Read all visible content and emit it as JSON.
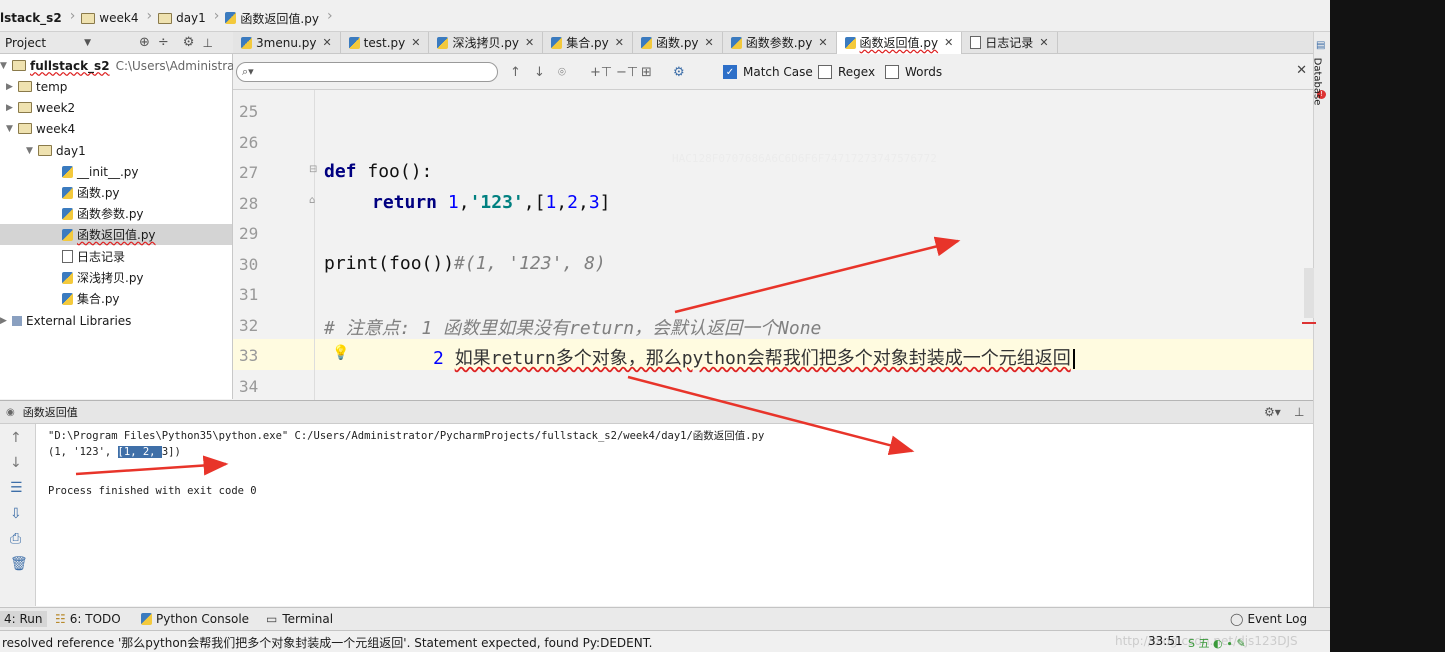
{
  "breadcrumb": [
    "lstack_s2",
    "week4",
    "day1",
    "函数返回值.py"
  ],
  "project_header": {
    "label": "Project"
  },
  "tabs": [
    {
      "label": "3menu.py",
      "active": false
    },
    {
      "label": "test.py",
      "active": false
    },
    {
      "label": "深浅拷贝.py",
      "active": false
    },
    {
      "label": "集合.py",
      "active": false
    },
    {
      "label": "函数.py",
      "active": false
    },
    {
      "label": "函数参数.py",
      "active": false
    },
    {
      "label": "函数返回值.py",
      "active": true
    },
    {
      "label": "日志记录",
      "active": false
    }
  ],
  "tree": {
    "root_name": "fullstack_s2",
    "root_path": "C:\\Users\\Administrator",
    "items": [
      {
        "label": "temp",
        "type": "folder"
      },
      {
        "label": "week2",
        "type": "folder"
      },
      {
        "label": "week4",
        "type": "folder"
      },
      {
        "label": "day1",
        "type": "folder"
      },
      {
        "label": "__init__.py",
        "type": "py"
      },
      {
        "label": "函数.py",
        "type": "py"
      },
      {
        "label": "函数参数.py",
        "type": "py"
      },
      {
        "label": "函数返回值.py",
        "type": "py"
      },
      {
        "label": "日志记录",
        "type": "txt"
      },
      {
        "label": "深浅拷贝.py",
        "type": "py"
      },
      {
        "label": "集合.py",
        "type": "py"
      },
      {
        "label": "External Libraries",
        "type": "lib"
      }
    ]
  },
  "search": {
    "match_case_label": "Match Case",
    "regex_label": "Regex",
    "words_label": "Words",
    "match_case_checked": true
  },
  "editor": {
    "line_numbers": [
      "25",
      "26",
      "27",
      "28",
      "29",
      "30",
      "31",
      "32",
      "33",
      "34"
    ],
    "watermark": "HAC128F0707686A6C6D6F6F74717273747576772",
    "code": {
      "l27_kw": "def",
      "l27_rest": " foo():",
      "l28_kw": "return",
      "l28_a": "1",
      "l28_b": "'123'",
      "l28_c1": "1",
      "l28_c2": "2",
      "l28_c3": "3",
      "l30_a": "print(foo())",
      "l30_cmt": "#(1, '123', 8)",
      "l32_cmt": "# 注意点: 1 函数里如果没有return，会默认返回一个None",
      "l33_num": "2",
      "l33_text": "如果return多个对象，那么python会帮我们把多个对象封装成一个元组返回"
    }
  },
  "run": {
    "title": "函数返回值",
    "cmd": "\"D:\\Program Files\\Python35\\python.exe\" C:/Users/Administrator/PycharmProjects/fullstack_s2/week4/day1/函数返回值.py",
    "out_prefix": "(1, '123', ",
    "out_selected": "[1, 2, ",
    "out_suffix": "3])",
    "finished": "Process finished with exit code 0"
  },
  "bottom_tools": {
    "run": "4: Run",
    "todo": "6: TODO",
    "python_console": "Python Console",
    "terminal": "Terminal",
    "event_log": "Event Log"
  },
  "status": {
    "message": "resolved reference '那么python会帮我们把多个对象封装成一个元组返回'. Statement expected, found Py:DEDENT.",
    "position": "33:51",
    "watermark": "http://blog.csdn.net/djs123DJS"
  },
  "side_panel": {
    "database_label": "Database"
  }
}
